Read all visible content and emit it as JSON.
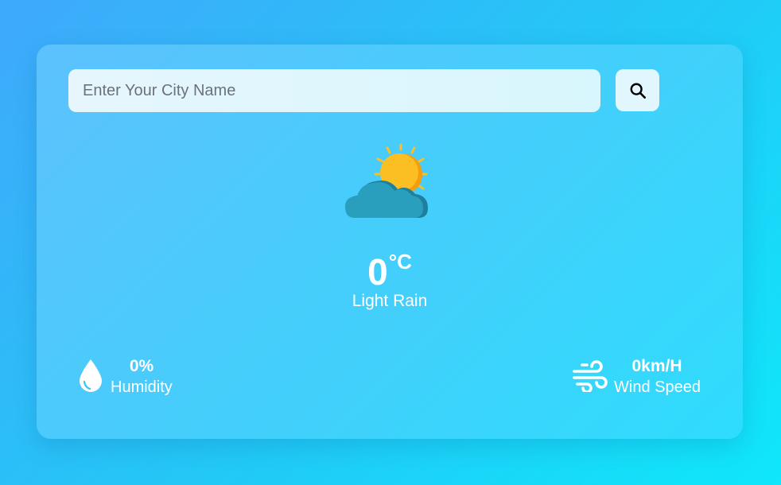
{
  "search": {
    "placeholder": "Enter Your City Name",
    "value": "",
    "button_icon": "search-icon"
  },
  "weather": {
    "icon": "partly-cloudy-icon",
    "temperature": "0",
    "unit": "°C",
    "condition": "Light Rain"
  },
  "humidity": {
    "icon": "water-drop-icon",
    "value": "0%",
    "label": "Humidity"
  },
  "wind": {
    "icon": "wind-icon",
    "value": "0km/H",
    "label": "Wind Speed"
  },
  "colors": {
    "background_start": "#3fa9fb",
    "background_end": "#0fe7fb",
    "sun": "#fbbf24",
    "cloud": "#2a9fbd",
    "text": "#ffffff"
  }
}
